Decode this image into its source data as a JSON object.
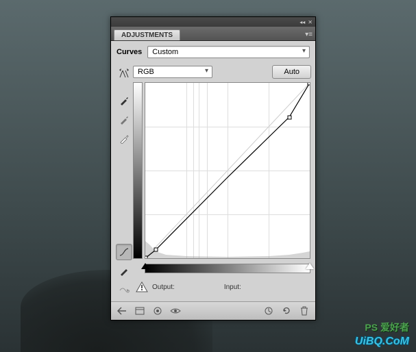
{
  "panel": {
    "tab": "ADJUSTMENTS",
    "preset_label": "Curves",
    "preset_value": "Custom",
    "channel_value": "RGB",
    "auto_label": "Auto",
    "output_label": "Output:",
    "input_label": "Input:"
  },
  "tools": {
    "target": "targeted-adjustment-icon",
    "eyedropper_black": "eyedropper-black-icon",
    "eyedropper_gray": "eyedropper-gray-icon",
    "eyedropper_white": "eyedropper-white-icon",
    "curve_mode": "curve-mode-icon",
    "pencil_mode": "pencil-mode-icon",
    "smooth": "smooth-icon"
  },
  "footer": {
    "back": "back-arrow-icon",
    "expand": "expand-icon",
    "clip": "clip-icon",
    "visibility": "eye-icon",
    "prev": "prev-state-icon",
    "reset": "reset-icon",
    "trash": "trash-icon"
  },
  "chart_data": {
    "type": "line",
    "title": "Curves",
    "xlabel": "Input",
    "ylabel": "Output",
    "xlim": [
      0,
      255
    ],
    "ylim": [
      0,
      255
    ],
    "series": [
      {
        "name": "baseline",
        "values": [
          [
            0,
            0
          ],
          [
            255,
            255
          ]
        ]
      },
      {
        "name": "curve",
        "values": [
          [
            0,
            0
          ],
          [
            16,
            12
          ],
          [
            128,
            118
          ],
          [
            223,
            205
          ],
          [
            255,
            255
          ]
        ]
      }
    ],
    "grid": true
  },
  "watermark": {
    "line1": "PS 爱好者",
    "line2": "UiBQ.CoM"
  }
}
